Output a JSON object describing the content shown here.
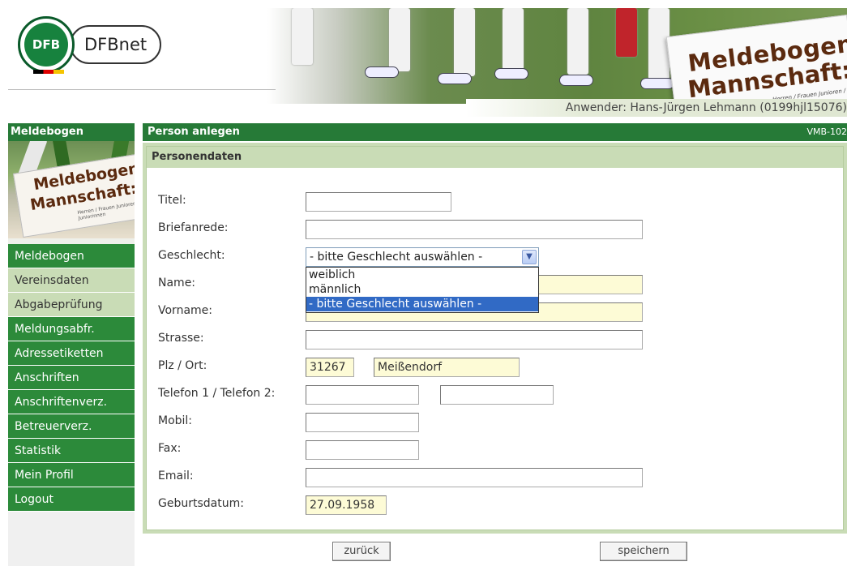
{
  "header": {
    "logo_text": "DFBnet",
    "banner_title_line1": "Meldebogen",
    "banner_title_line2": "Mannschaft:",
    "banner_subtitle": "Herren / Frauen  Junioren / Juniorinnen",
    "user_line": "Anwender: Hans-Jürgen Lehmann (0199hjl15076)"
  },
  "sidebar": {
    "title": "Meldebogen",
    "image_text_line1": "Meldebogen",
    "image_text_line2": "Mannschaft:",
    "image_subtitle": "Herren / Frauen  Junioren / Juniorinnen",
    "items": [
      {
        "label": "Meldebogen",
        "style": "dark"
      },
      {
        "label": "Vereinsdaten",
        "style": "light"
      },
      {
        "label": "Abgabeprüfung",
        "style": "light"
      },
      {
        "label": "Meldungsabfr.",
        "style": "dark"
      },
      {
        "label": "Adressetiketten",
        "style": "dark"
      },
      {
        "label": "Anschriften",
        "style": "dark"
      },
      {
        "label": "Anschriftenverz.",
        "style": "dark"
      },
      {
        "label": "Betreuerverz.",
        "style": "dark"
      },
      {
        "label": "Statistik",
        "style": "dark"
      },
      {
        "label": "Mein Profil",
        "style": "dark"
      },
      {
        "label": "Logout",
        "style": "dark"
      }
    ]
  },
  "main": {
    "title": "Person anlegen",
    "code": "VMB-102",
    "section_title": "Personendaten"
  },
  "form": {
    "titel_label": "Titel:",
    "titel_value": "",
    "briefanrede_label": "Briefanrede:",
    "briefanrede_value": "",
    "geschlecht_label": "Geschlecht:",
    "geschlecht_selected": "- bitte Geschlecht auswählen -",
    "geschlecht_options": [
      "weiblich",
      "männlich",
      "- bitte Geschlecht auswählen -"
    ],
    "name_label": "Name:",
    "name_value": "",
    "vorname_label": "Vorname:",
    "vorname_value": "",
    "strasse_label": "Strasse:",
    "strasse_value": "",
    "plzort_label": "Plz / Ort:",
    "plz_value": "31267",
    "ort_value": "Meißendorf",
    "telefon_label": "Telefon 1 / Telefon 2:",
    "telefon1_value": "",
    "telefon2_value": "",
    "mobil_label": "Mobil:",
    "mobil_value": "",
    "fax_label": "Fax:",
    "fax_value": "",
    "email_label": "Email:",
    "email_value": "",
    "geburtsdatum_label": "Geburtsdatum:",
    "geburtsdatum_value": "27.09.1958"
  },
  "buttons": {
    "back": "zurück",
    "save": "speichern"
  },
  "colors": {
    "brand_green": "#267a37",
    "nav_green": "#2c8a3a",
    "light_green": "#c9dcb6",
    "field_yellow": "#fdfbd6",
    "select_highlight": "#316ac5"
  }
}
